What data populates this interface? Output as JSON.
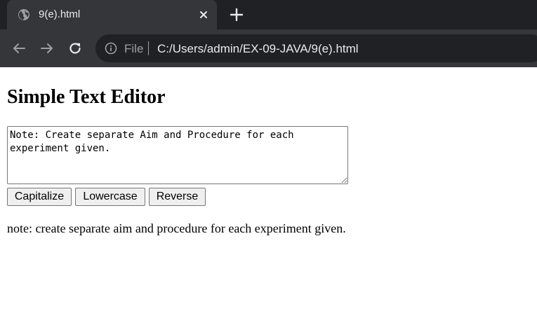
{
  "browser": {
    "tab": {
      "title": "9(e).html",
      "favicon": "globe-icon"
    },
    "toolbar": {
      "scheme_label": "File",
      "url": "C:/Users/admin/EX-09-JAVA/9(e).html"
    },
    "colors": {
      "tab_strip": "#202124",
      "toolbar": "#35363a",
      "omnibox": "#202124",
      "text_light": "#e8eaed",
      "text_muted": "#9aa0a6"
    }
  },
  "page": {
    "title": "Simple Text Editor",
    "editor": {
      "value": "Note: Create separate Aim and Procedure for each experiment given."
    },
    "buttons": {
      "capitalize": "Capitalize",
      "lowercase": "Lowercase",
      "reverse": "Reverse"
    },
    "output": "note: create separate aim and procedure for each experiment given."
  }
}
